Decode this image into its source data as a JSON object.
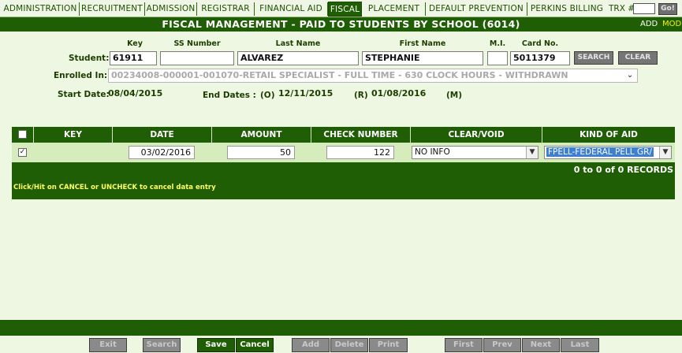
{
  "nav": {
    "items": [
      "ADMINISTRATION",
      "RECRUITMENT",
      "ADMISSION",
      "REGISTRAR",
      "FINANCIAL AID",
      "FISCAL",
      "PLACEMENT",
      "DEFAULT PREVENTION",
      "PERKINS BILLING"
    ],
    "active": "FISCAL",
    "trx_label": "TRX #:",
    "trx_value": "",
    "go_label": "Go!"
  },
  "header": {
    "title": "FISCAL MANAGEMENT - PAID TO STUDENTS BY SCHOOL (6014)",
    "add_label": "ADD",
    "mod_label": "MOD"
  },
  "student": {
    "label": "Student:",
    "columns": {
      "key": "Key",
      "ss": "SS Number",
      "last": "Last Name",
      "first": "First Name",
      "mi": "M.I.",
      "card": "Card No."
    },
    "key": "61911",
    "ss_number": "",
    "last_name": "ALVAREZ",
    "first_name": "STEPHANIE",
    "mi": "",
    "card_no": "5011379",
    "search_label": "SEARCH",
    "clear_label": "CLEAR"
  },
  "enrollment": {
    "label": "Enrolled In:",
    "value": "00234008-000001-001070-RETAIL SPECIALIST - FULL TIME - 630 CLOCK HOURS - WITHDRAWN"
  },
  "dates": {
    "start_label": "Start Date:",
    "start_value": "08/04/2015",
    "end_label": "End Dates :",
    "o_label": "(O)",
    "o_value": "12/11/2015",
    "r_label": "(R)",
    "r_value": "01/08/2016",
    "m_label": "(M)"
  },
  "grid": {
    "headers": {
      "key": "KEY",
      "date": "DATE",
      "amount": "AMOUNT",
      "check": "CHECK NUMBER",
      "clear": "CLEAR/VOID",
      "aid": "KIND OF AID"
    },
    "row": {
      "checked": true,
      "key": "",
      "date": "03/02/2016",
      "amount": "50",
      "check_number": "122",
      "clear_void": "NO INFO",
      "kind_of_aid": "FPELL-FEDERAL PELL GR/"
    },
    "records": "0 to 0 of 0 RECORDS",
    "hint": "Click/Hit on CANCEL or UNCHECK to cancel data entry"
  },
  "actions": {
    "exit": "Exit",
    "search": "Search",
    "save": "Save",
    "cancel": "Cancel",
    "add": "Add",
    "delete": "Delete",
    "print": "Print",
    "first": "First",
    "prev": "Prev",
    "next": "Next",
    "last": "Last"
  },
  "colors": {
    "primary": "#1f5e04",
    "background": "#eef7e1",
    "row": "#d6ecbc",
    "hint": "#ffff66",
    "selected": "#3c7fd6"
  }
}
